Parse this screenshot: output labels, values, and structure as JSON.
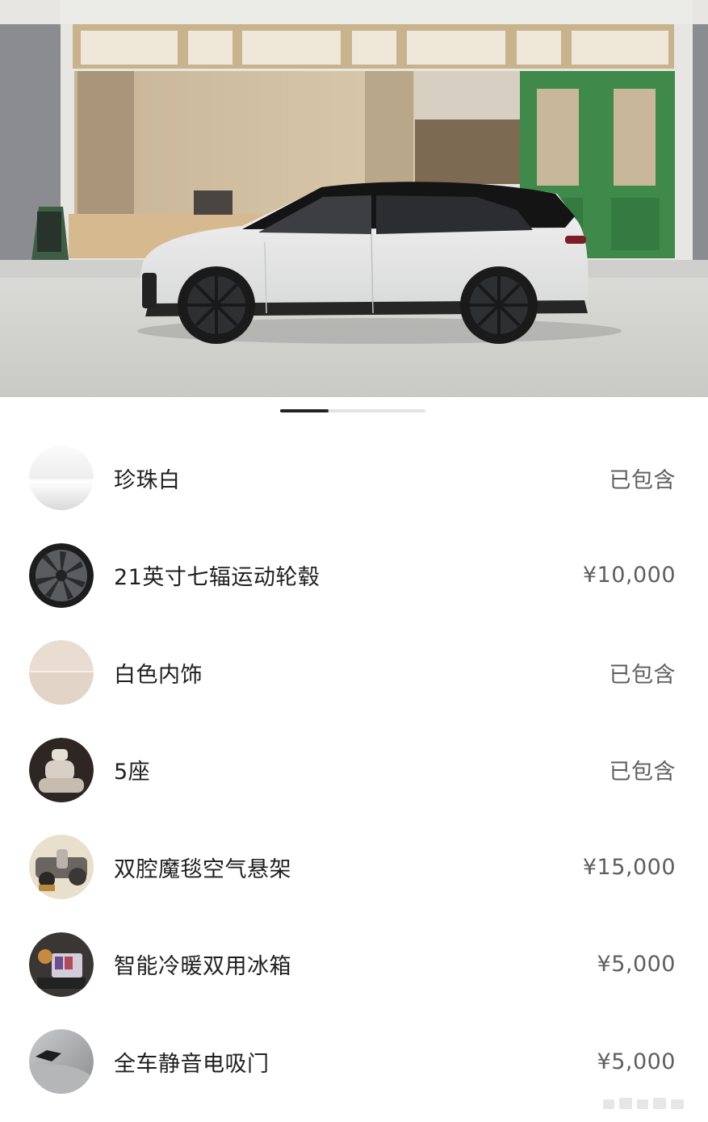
{
  "gallery": {
    "image_alt": "white SUV side view in front of storefront",
    "pager": {
      "total": 3,
      "active": 1
    }
  },
  "options": [
    {
      "name": "珍珠白",
      "price": "已包含",
      "icon": "pearl-white-swatch-icon"
    },
    {
      "name": "21英寸七辐运动轮毂",
      "price": "¥10,000",
      "icon": "wheel-icon"
    },
    {
      "name": "白色内饰",
      "price": "已包含",
      "icon": "interior-swatch-icon"
    },
    {
      "name": "5座",
      "price": "已包含",
      "icon": "seat-icon"
    },
    {
      "name": "双腔魔毯空气悬架",
      "price": "¥15,000",
      "icon": "suspension-icon"
    },
    {
      "name": "智能冷暖双用冰箱",
      "price": "¥5,000",
      "icon": "fridge-icon"
    },
    {
      "name": "全车静音电吸门",
      "price": "¥5,000",
      "icon": "door-icon"
    }
  ],
  "colors": {
    "text_primary": "#1f1f1f",
    "text_secondary": "#5e5e5e",
    "pager_active": "#222222",
    "pager_track": "#e3e3e3"
  }
}
